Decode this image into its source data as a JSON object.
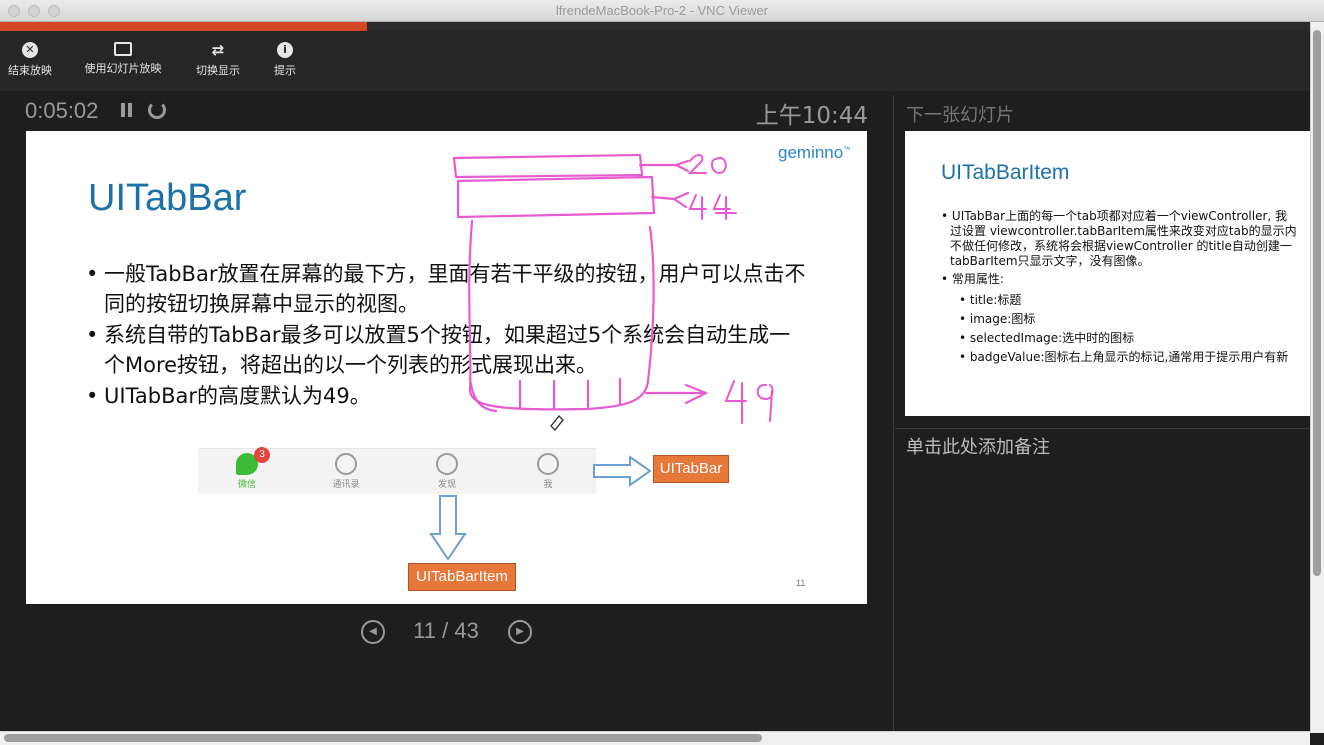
{
  "window": {
    "title": "lfrendeMacBook-Pro-2 - VNC Viewer"
  },
  "progress": {
    "fraction": 0.28,
    "color": "#d24726"
  },
  "toolbar": {
    "items": [
      {
        "label": "结束放映",
        "icon": "close-circle-icon"
      },
      {
        "label": "使用幻灯片放映",
        "icon": "slides-icon"
      },
      {
        "label": "切换显示",
        "icon": "swap-icon"
      },
      {
        "label": "提示",
        "icon": "info-icon"
      }
    ]
  },
  "presenter": {
    "timer": "0:05:02",
    "clock": "上午10:44",
    "page": "11 / 43",
    "next_label": "下一张幻灯片",
    "notes_placeholder": "单击此处添加备注"
  },
  "slide": {
    "title": "UITabBar",
    "logo": "geminno",
    "logo_mark": "™",
    "bullets": [
      "一般TabBar放置在屏幕的最下方，里面有若干平级的按钮，用户可以点击不同的按钮切换屏幕中显示的视图。",
      "系统自带的TabBar最多可以放置5个按钮，如果超过5个系统会自动生成一个More按钮，将超出的以一个列表的形式展现出来。",
      "UITabBar的高度默认为49。"
    ],
    "tabs": [
      "微信",
      "通讯录",
      "发现",
      "我"
    ],
    "badge": "3",
    "label_tabbar": "UITabBar",
    "label_item": "UITabBarItem",
    "number": "11",
    "ink_numbers": [
      "20",
      "44",
      "49"
    ],
    "accent_color": "#1b72a8",
    "ink_color": "#e85bd0"
  },
  "next_slide": {
    "title": "UITabBarItem",
    "bullets": [
      "UITabBar上面的每一个tab项都对应着一个viewController, 我",
      "过设置 viewcontroller.tabBarItem属性来改变对应tab的显示内",
      "不做任何修改，系统将会根据viewController 的title自动创建一",
      "tabBarItem只显示文字，没有图像。"
    ],
    "common_label": "常用属性:",
    "props": [
      "title:标题",
      "image:图标",
      "selectedImage:选中时的图标",
      "badgeValue:图标右上角显示的标记,通常用于提示用户有新"
    ]
  }
}
